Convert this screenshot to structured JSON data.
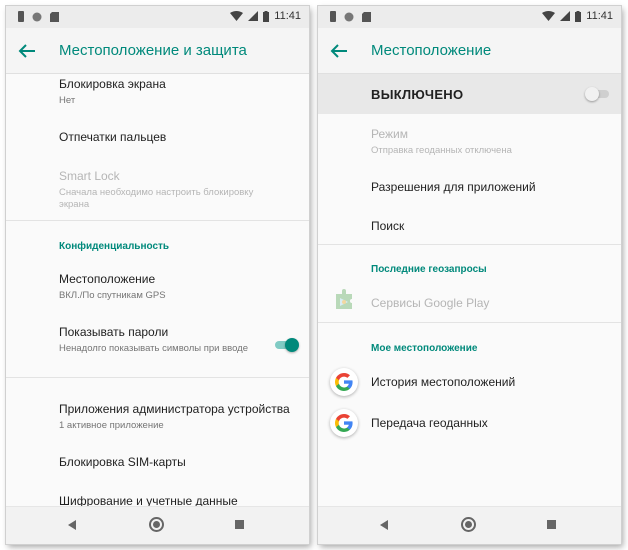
{
  "status_bar": {
    "time": "11:41"
  },
  "left": {
    "title": "Местоположение и защита",
    "items": {
      "screen_lock": {
        "title": "Блокировка экрана",
        "sub": "Нет"
      },
      "fingerprints": {
        "title": "Отпечатки пальцев"
      },
      "smart_lock": {
        "title": "Smart Lock",
        "sub": "Сначала необходимо настроить блокировку экрана"
      },
      "privacy_header": "Конфиденциальность",
      "location": {
        "title": "Местоположение",
        "sub": "ВКЛ./По спутникам GPS"
      },
      "show_passwords": {
        "title": "Показывать пароли",
        "sub": "Ненадолго показывать символы при вводе",
        "enabled": true
      },
      "device_admin": {
        "title": "Приложения администратора устройства",
        "sub": "1 активное приложение"
      },
      "sim_lock": {
        "title": "Блокировка SIM-карты"
      },
      "encryption": {
        "title": "Шифрование и учетные данные"
      }
    }
  },
  "right": {
    "title": "Местоположение",
    "master": {
      "label": "ВЫКЛЮЧЕНО",
      "enabled": false
    },
    "items": {
      "mode": {
        "title": "Режим",
        "sub": "Отправка геоданных отключена"
      },
      "app_permissions": {
        "title": "Разрешения для приложений"
      },
      "search": {
        "title": "Поиск"
      },
      "recent_header": "Последние геозапросы",
      "play_services": {
        "title": "Сервисы Google Play"
      },
      "my_location_header": "Мое местоположение",
      "location_history": {
        "title": "История местоположений"
      },
      "location_sharing": {
        "title": "Передача геоданных"
      }
    }
  },
  "colors": {
    "accent": "#00897b",
    "text": "#212121",
    "secondary": "#757575",
    "disabled": "#b5b5b5"
  },
  "icons": [
    "back-arrow-icon",
    "wifi-icon",
    "signal-icon",
    "battery-icon",
    "google-icon",
    "play-services-icon",
    "nav-back-icon",
    "nav-home-icon",
    "nav-recents-icon"
  ]
}
